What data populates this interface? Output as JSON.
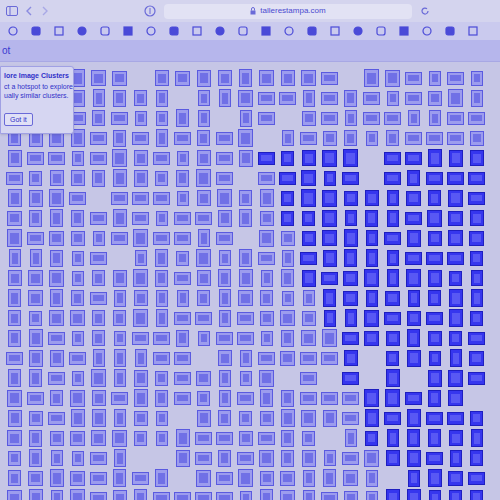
{
  "browser": {
    "url": "tallerestampa.com"
  },
  "header": {
    "title": "ot"
  },
  "tooltip": {
    "title": "lore Image Clusters",
    "lines": [
      "ct a hotspot to explore",
      "ually similar clusters."
    ],
    "button": "Got it"
  }
}
